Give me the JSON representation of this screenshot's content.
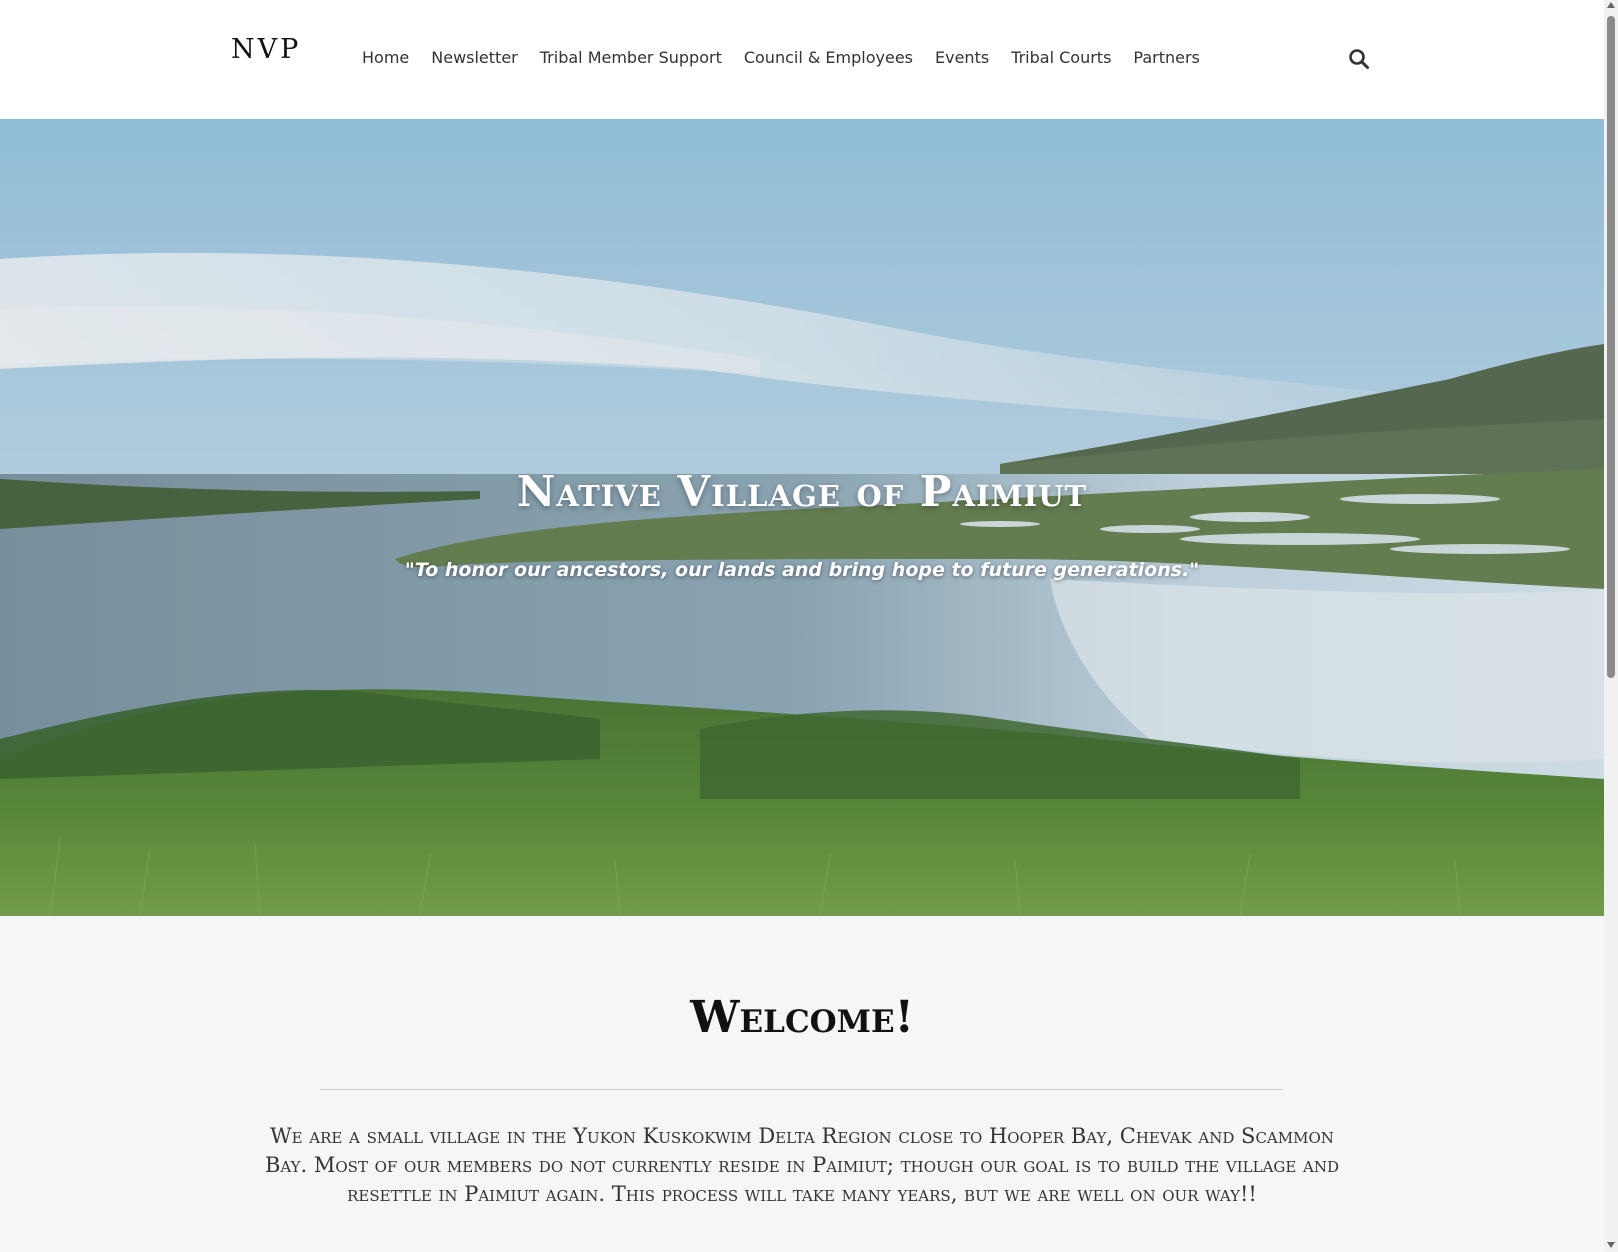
{
  "header": {
    "logo": "NVP",
    "nav": [
      {
        "label": "Home"
      },
      {
        "label": "Newsletter"
      },
      {
        "label": "Tribal Member Support"
      },
      {
        "label": "Council & Employees"
      },
      {
        "label": "Events"
      },
      {
        "label": "Tribal Courts"
      },
      {
        "label": "Partners"
      }
    ],
    "search_icon": "search-icon"
  },
  "hero": {
    "title": "Native Village of Paimiut",
    "quote": "\"To honor our ancestors, our lands and bring hope to future generations.\""
  },
  "welcome": {
    "heading": "Welcome!",
    "text": "We are a small village in the Yukon Kuskokwim Delta Region close to Hooper Bay, Chevak and Scammon Bay.  Most of our members do not currently reside in Paimiut; though our goal is to build the village and resettle in Paimiut again. This process will take many years, but we are well on our way!!"
  },
  "colors": {
    "header_bg": "#ffffff",
    "page_bg": "#f6f6f6",
    "hero_text": "#ffffff"
  }
}
